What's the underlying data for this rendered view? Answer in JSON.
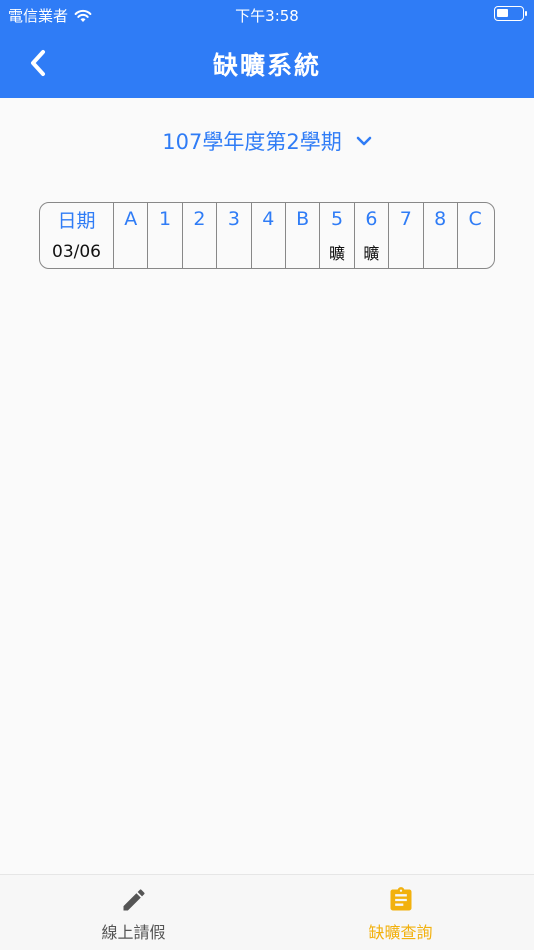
{
  "status_bar": {
    "carrier": "電信業者",
    "time": "下午3:58",
    "battery_level": 0.45
  },
  "nav": {
    "title": "缺曠系統"
  },
  "semester": {
    "label": "107學年度第2學期"
  },
  "table": {
    "date_header": "日期",
    "period_headers": [
      "A",
      "1",
      "2",
      "3",
      "4",
      "B",
      "5",
      "6",
      "7",
      "8",
      "C"
    ],
    "rows": [
      {
        "date": "03/06",
        "cells": [
          "",
          "",
          "",
          "",
          "",
          "",
          "曠",
          "曠",
          "",
          "",
          ""
        ]
      }
    ]
  },
  "tabs": [
    {
      "label": "線上請假",
      "icon": "pencil-icon",
      "active": false
    },
    {
      "label": "缺曠查詢",
      "icon": "clipboard-icon",
      "active": true
    }
  ],
  "colors": {
    "primary": "#2f7cf6",
    "active_tab": "#f2b10e",
    "inactive_tab": "#555555"
  }
}
